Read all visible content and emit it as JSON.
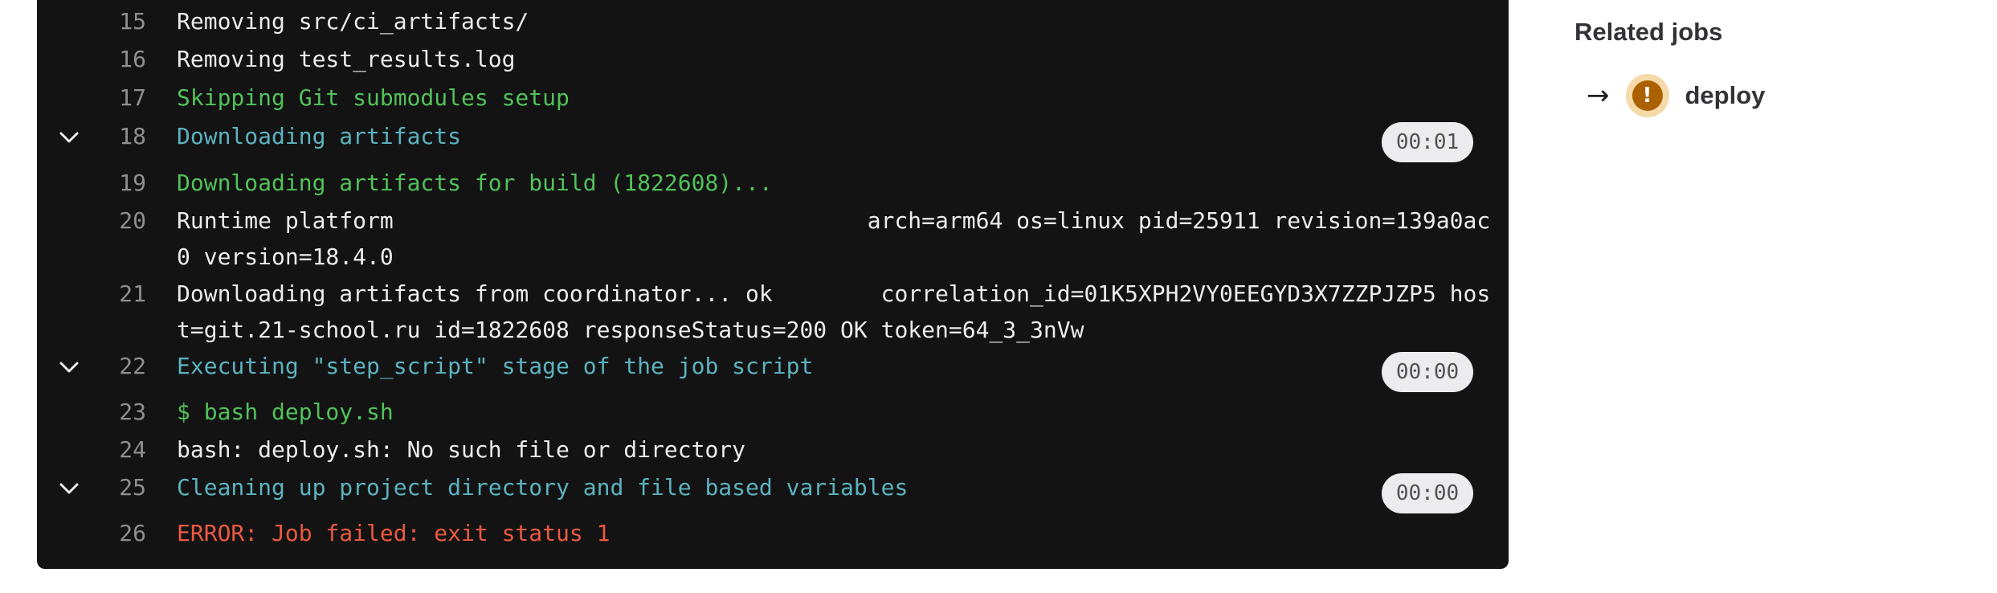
{
  "log": {
    "lines": [
      {
        "num": "15",
        "text": "Removing src/ci_artifacts/"
      },
      {
        "num": "16",
        "text": "Removing test_results.log"
      },
      {
        "num": "17",
        "text": "Skipping Git submodules setup"
      },
      {
        "num": "18",
        "text": "Downloading artifacts",
        "duration": "00:01"
      },
      {
        "num": "19",
        "text": "Downloading artifacts for build (1822608)..."
      },
      {
        "num": "20",
        "text": "Runtime platform                                   arch=arm64 os=linux pid=25911 revision=139a0ac0 version=18.4.0"
      },
      {
        "num": "21",
        "text": "Downloading artifacts from coordinator... ok        correlation_id=01K5XPH2VY0EEGYD3X7ZZPJZP5 host=git.21-school.ru id=1822608 responseStatus=200 OK token=64_3_3nVw"
      },
      {
        "num": "22",
        "text": "Executing \"step_script\" stage of the job script",
        "duration": "00:00"
      },
      {
        "num": "23",
        "text": "$ bash deploy.sh"
      },
      {
        "num": "24",
        "text": "bash: deploy.sh: No such file or directory"
      },
      {
        "num": "25",
        "text": "Cleaning up project directory and file based variables",
        "duration": "00:00"
      },
      {
        "num": "26",
        "text": "ERROR: Job failed: exit status 1"
      }
    ]
  },
  "sidebar": {
    "title": "Related jobs",
    "jobs": [
      {
        "name": "deploy",
        "status_icon": "warning-status-icon"
      }
    ]
  },
  "colors": {
    "log_background": "#131313",
    "success_text": "#52c25b",
    "section_text": "#5cb3bf",
    "error_text": "#ec5941",
    "warning_status": "#ab6100"
  }
}
